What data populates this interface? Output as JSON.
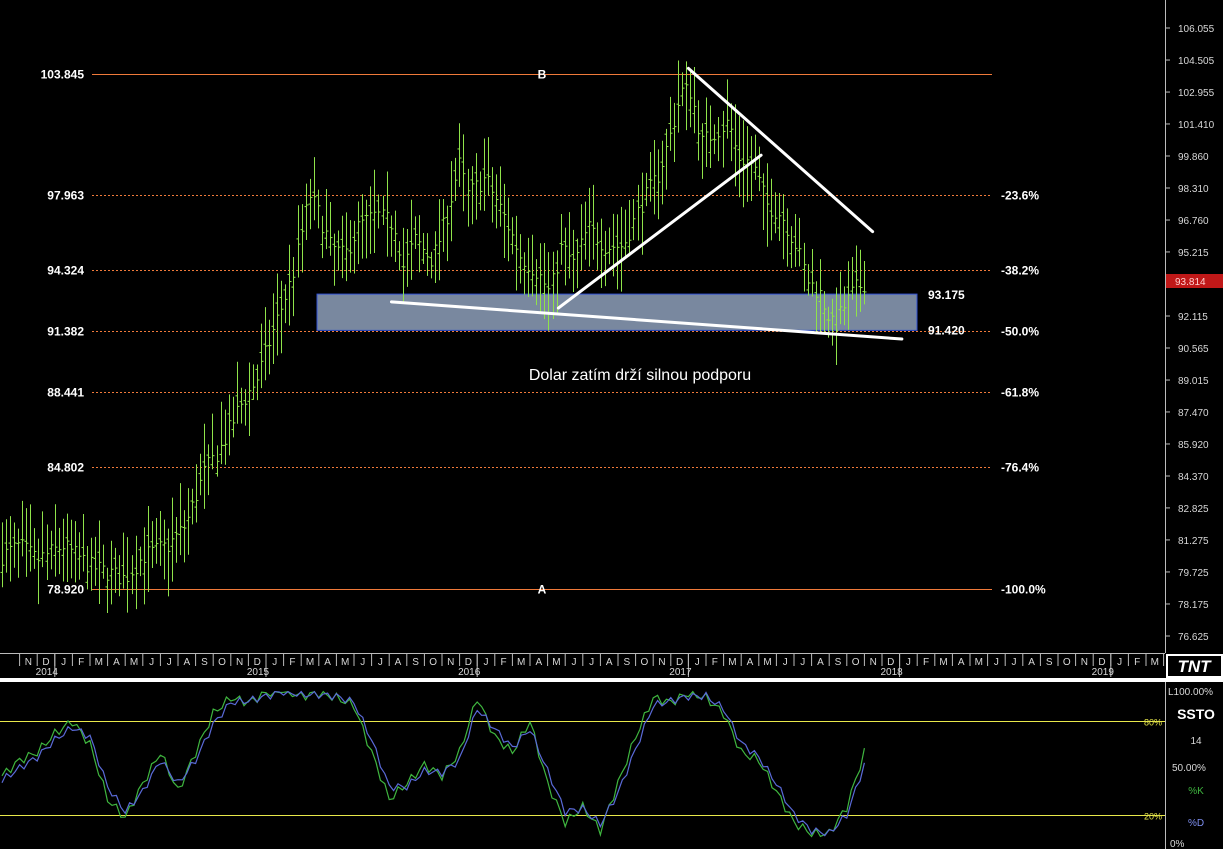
{
  "chart_data": [
    {
      "type": "bar",
      "subtype": "ohlc",
      "instrument": "US Dollar Index (weekly)",
      "x_range": [
        "2013-10",
        "2019-05"
      ],
      "ylim": [
        75.0,
        107.0
      ],
      "y_ticks": [
        "106.055",
        "104.505",
        "102.955",
        "101.410",
        "99.860",
        "98.310",
        "96.760",
        "95.215",
        "93.665",
        "92.115",
        "90.565",
        "89.015",
        "87.470",
        "85.920",
        "84.370",
        "82.825",
        "81.275",
        "79.725",
        "78.175",
        "76.625"
      ],
      "last_price": "93.814",
      "fib_levels": [
        {
          "price_label": "103.845",
          "value": 103.845,
          "pct": "",
          "marker": "B"
        },
        {
          "price_label": "97.963",
          "value": 97.963,
          "pct": "-23.6%",
          "marker": ""
        },
        {
          "price_label": "94.324",
          "value": 94.324,
          "pct": "-38.2%",
          "marker": ""
        },
        {
          "price_label": "91.382",
          "value": 91.382,
          "pct": "-50.0%",
          "marker": ""
        },
        {
          "price_label": "88.441",
          "value": 88.441,
          "pct": "-61.8%",
          "marker": ""
        },
        {
          "price_label": "84.802",
          "value": 84.802,
          "pct": "-76.4%",
          "marker": ""
        },
        {
          "price_label": "78.920",
          "value": 78.92,
          "pct": "-100.0%",
          "marker": "A"
        }
      ],
      "support_zone": {
        "upper": 93.175,
        "lower": 91.42,
        "upper_label": "93.175",
        "lower_label": "91.420",
        "start": "2015-06",
        "end": "2017-12"
      },
      "trendlines": [
        {
          "name": "descending resistance",
          "from": [
            "2017-01-01",
            104.1
          ],
          "to": [
            "2017-11-15",
            96.2
          ]
        },
        {
          "name": "rising trendline",
          "from": [
            "2016-05-20",
            92.5
          ],
          "to": [
            "2017-05-05",
            99.9
          ]
        },
        {
          "name": "descending support",
          "from": [
            "2015-08-05",
            92.8
          ],
          "to": [
            "2018-01-05",
            91.0
          ]
        }
      ],
      "annotation": "Dolar zatím drží silnou podporu",
      "x_months": [
        "N",
        "D",
        "J",
        "F",
        "M",
        "A",
        "M",
        "J",
        "J",
        "A",
        "S",
        "O",
        "N",
        "D",
        "J",
        "F",
        "M",
        "A",
        "M",
        "J",
        "J",
        "A",
        "S",
        "O",
        "N",
        "D",
        "J",
        "F",
        "M",
        "A",
        "M",
        "J",
        "J",
        "A",
        "S",
        "O",
        "N",
        "D",
        "J",
        "F",
        "M",
        "A",
        "M",
        "J",
        "J",
        "A",
        "S",
        "O",
        "N",
        "D",
        "J",
        "F",
        "M",
        "A",
        "M",
        "J",
        "J",
        "A",
        "S",
        "O",
        "N",
        "D",
        "J",
        "F",
        "M",
        "A",
        "M"
      ],
      "x_years": [
        {
          "label": "2014",
          "date": "2014-01"
        },
        {
          "label": "2015",
          "date": "2015-01"
        },
        {
          "label": "2016",
          "date": "2016-01"
        },
        {
          "label": "2017",
          "date": "2017-01"
        },
        {
          "label": "2018",
          "date": "2018-01"
        },
        {
          "label": "2019",
          "date": "2019-01"
        }
      ],
      "price_path": [
        [
          "2013-10-01",
          80.5
        ],
        [
          "2013-11-01",
          81.0
        ],
        [
          "2013-12-01",
          80.3
        ],
        [
          "2014-01-15",
          81.0
        ],
        [
          "2014-03-01",
          80.0
        ],
        [
          "2014-05-01",
          79.4
        ],
        [
          "2014-06-01",
          80.5
        ],
        [
          "2014-07-15",
          81.0
        ],
        [
          "2014-08-15",
          82.0
        ],
        [
          "2014-09-15",
          84.5
        ],
        [
          "2014-10-15",
          85.8
        ],
        [
          "2014-11-15",
          87.7
        ],
        [
          "2014-12-15",
          89.0
        ],
        [
          "2015-01-15",
          91.5
        ],
        [
          "2015-02-15",
          94.0
        ],
        [
          "2015-03-15",
          98.0
        ],
        [
          "2015-04-01",
          97.0
        ],
        [
          "2015-04-20",
          95.5
        ],
        [
          "2015-05-15",
          95.0
        ],
        [
          "2015-06-10",
          96.5
        ],
        [
          "2015-07-10",
          97.0
        ],
        [
          "2015-08-10",
          96.5
        ],
        [
          "2015-08-25",
          94.5
        ],
        [
          "2015-09-15",
          95.8
        ],
        [
          "2015-10-15",
          94.8
        ],
        [
          "2015-11-10",
          97.0
        ],
        [
          "2015-11-30",
          99.5
        ],
        [
          "2015-12-15",
          98.0
        ],
        [
          "2016-01-15",
          98.8
        ],
        [
          "2016-02-15",
          97.0
        ],
        [
          "2016-03-15",
          95.0
        ],
        [
          "2016-04-15",
          94.2
        ],
        [
          "2016-05-05",
          93.2
        ],
        [
          "2016-05-25",
          95.5
        ],
        [
          "2016-06-15",
          94.6
        ],
        [
          "2016-07-10",
          96.4
        ],
        [
          "2016-08-10",
          95.5
        ],
        [
          "2016-09-10",
          95.5
        ],
        [
          "2016-10-10",
          97.5
        ],
        [
          "2016-11-10",
          99.0
        ],
        [
          "2016-12-01",
          101.0
        ],
        [
          "2016-12-20",
          103.0
        ],
        [
          "2017-01-05",
          103.0
        ],
        [
          "2017-01-25",
          100.5
        ],
        [
          "2017-02-15",
          101.0
        ],
        [
          "2017-03-10",
          101.5
        ],
        [
          "2017-03-25",
          99.8
        ],
        [
          "2017-04-20",
          99.5
        ],
        [
          "2017-05-15",
          97.5
        ],
        [
          "2017-06-10",
          97.0
        ],
        [
          "2017-07-05",
          95.5
        ],
        [
          "2017-07-25",
          93.8
        ],
        [
          "2017-08-15",
          93.2
        ],
        [
          "2017-09-08",
          91.5
        ],
        [
          "2017-09-25",
          92.5
        ],
        [
          "2017-10-15",
          93.4
        ],
        [
          "2017-11-05",
          93.8
        ]
      ]
    },
    {
      "type": "line",
      "indicator": "SSTO",
      "period": "14",
      "ylim": [
        0,
        100
      ],
      "levels": [
        {
          "value": 80,
          "label": "80%"
        },
        {
          "value": 20,
          "label": "20%"
        }
      ],
      "scale_labels": [
        "100.00%",
        "50.00%",
        "0%"
      ],
      "series": [
        {
          "name": "%K",
          "color": "#3fb63f",
          "x": [
            "2013-10",
            "2013-11",
            "2013-12",
            "2014-01",
            "2014-02",
            "2014-03",
            "2014-04",
            "2014-05",
            "2014-06",
            "2014-07",
            "2014-08",
            "2014-09",
            "2014-10",
            "2014-11",
            "2014-12",
            "2015-01",
            "2015-02",
            "2015-03",
            "2015-04",
            "2015-05",
            "2015-06",
            "2015-07",
            "2015-08",
            "2015-09",
            "2015-10",
            "2015-11",
            "2015-12",
            "2016-01",
            "2016-02",
            "2016-03",
            "2016-04",
            "2016-05",
            "2016-06",
            "2016-07",
            "2016-08",
            "2016-09",
            "2016-10",
            "2016-11",
            "2016-12",
            "2017-01",
            "2017-02",
            "2017-03",
            "2017-04",
            "2017-05",
            "2017-06",
            "2017-07",
            "2017-08",
            "2017-09",
            "2017-10",
            "2017-11"
          ],
          "values": [
            45,
            55,
            60,
            72,
            80,
            65,
            30,
            18,
            40,
            60,
            35,
            60,
            85,
            95,
            92,
            98,
            100,
            96,
            98,
            95,
            90,
            60,
            30,
            40,
            52,
            45,
            60,
            95,
            70,
            60,
            80,
            40,
            15,
            25,
            10,
            40,
            70,
            95,
            92,
            98,
            95,
            85,
            60,
            55,
            35,
            15,
            8,
            8,
            25,
            60
          ]
        },
        {
          "name": "%D",
          "color": "#5a6ad8",
          "x": [
            "2013-10",
            "2013-11",
            "2013-12",
            "2014-01",
            "2014-02",
            "2014-03",
            "2014-04",
            "2014-05",
            "2014-06",
            "2014-07",
            "2014-08",
            "2014-09",
            "2014-10",
            "2014-11",
            "2014-12",
            "2015-01",
            "2015-02",
            "2015-03",
            "2015-04",
            "2015-05",
            "2015-06",
            "2015-07",
            "2015-08",
            "2015-09",
            "2015-10",
            "2015-11",
            "2015-12",
            "2016-01",
            "2016-02",
            "2016-03",
            "2016-04",
            "2016-05",
            "2016-06",
            "2016-07",
            "2016-08",
            "2016-09",
            "2016-10",
            "2016-11",
            "2016-12",
            "2017-01",
            "2017-02",
            "2017-03",
            "2017-04",
            "2017-05",
            "2017-06",
            "2017-07",
            "2017-08",
            "2017-09",
            "2017-10",
            "2017-11"
          ],
          "values": [
            42,
            50,
            57,
            68,
            76,
            70,
            38,
            22,
            35,
            55,
            40,
            55,
            78,
            92,
            93,
            96,
            99,
            97,
            97,
            96,
            92,
            68,
            38,
            38,
            48,
            47,
            55,
            88,
            75,
            63,
            75,
            48,
            22,
            24,
            14,
            34,
            62,
            90,
            93,
            96,
            96,
            88,
            66,
            57,
            40,
            20,
            10,
            8,
            20,
            52
          ]
        }
      ]
    }
  ],
  "ui": {
    "logo": "TNT",
    "indicator_name": "SSTO",
    "indicator_period": "14",
    "indicator_k_label": "%K",
    "indicator_d_label": "%D",
    "indicator_top_label": "L100.00%",
    "indicator_mid_label": "50.00%",
    "indicator_bottom_label": "0%",
    "ind_level_80": "80%",
    "ind_level_20": "20%",
    "colors": {
      "background": "#000000",
      "bars": "#8fe34a",
      "fib_line": "#f07a3a",
      "zone_fill": "#8090a8",
      "zone_border": "#3355dd",
      "trendline": "#ffffff",
      "last_price_bg": "#c01818",
      "level_line": "#e8e84a",
      "k_line": "#3fb63f",
      "d_line": "#5a6ad8"
    }
  }
}
